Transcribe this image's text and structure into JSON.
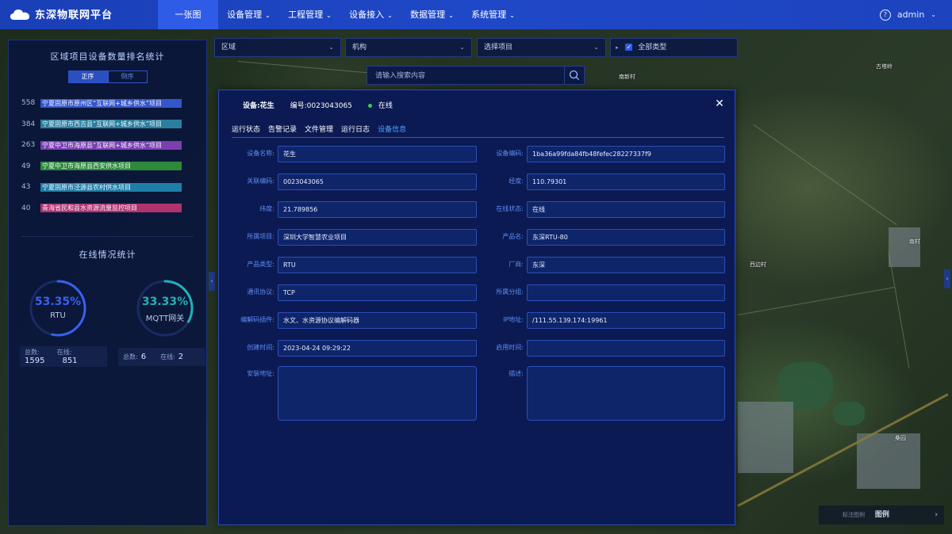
{
  "app": {
    "title": "东深物联网平台",
    "user": "admin"
  },
  "nav": {
    "items": [
      {
        "label": "一张图",
        "dropdown": false
      },
      {
        "label": "设备管理",
        "dropdown": true
      },
      {
        "label": "工程管理",
        "dropdown": true
      },
      {
        "label": "设备接入",
        "dropdown": true
      },
      {
        "label": "数据管理",
        "dropdown": true
      },
      {
        "label": "系统管理",
        "dropdown": true
      }
    ]
  },
  "left": {
    "rank_title": "区域项目设备数量排名统计",
    "sort": {
      "asc": "正序",
      "desc": "倒序"
    },
    "rankings": [
      {
        "count": "558",
        "name": "宁夏固原市原州区“互联网+城乡供水”项目",
        "color": "#3556c9"
      },
      {
        "count": "384",
        "name": "宁夏固原市西吉县“互联网+城乡供水”项目",
        "color": "#2a7f9c"
      },
      {
        "count": "263",
        "name": "宁夏中卫市海原县“互联网+城乡供水”项目",
        "color": "#7b3fb0"
      },
      {
        "count": "49",
        "name": "宁夏中卫市海原县西安供水项目",
        "color": "#2e8a3a"
      },
      {
        "count": "43",
        "name": "宁夏固原市泾源县农村供水项目",
        "color": "#1f7ea8"
      },
      {
        "count": "40",
        "name": "青海省民和县水资源流量监控项目",
        "color": "#b0336e"
      }
    ],
    "online_title": "在线情况统计",
    "gauges": [
      {
        "pct": "53.35%",
        "name": "RTU",
        "color": "#3a5ff0",
        "fraction": 0.5335,
        "total_label": "总数:",
        "total": "1595",
        "online_label": "在线:",
        "online": "851"
      },
      {
        "pct": "33.33%",
        "name": "MQTT网关",
        "color": "#1fb3b8",
        "fraction": 0.3333,
        "total_label": "总数:",
        "total": "6",
        "online_label": "在线:",
        "online": "2"
      }
    ]
  },
  "filters": {
    "region": "区域",
    "org": "机构",
    "project_placeholder": "选择项目",
    "all_types": "全部类型"
  },
  "search": {
    "placeholder": "请输入搜索内容"
  },
  "modal": {
    "device": "设备:花生",
    "code": "编号:0023043065",
    "status": "在线",
    "tabs": [
      "运行状态",
      "告警记录",
      "文件管理",
      "运行日志",
      "设备信息"
    ],
    "fields": [
      {
        "label": "设备名称:",
        "value": "花生"
      },
      {
        "label": "设备编码:",
        "value": "1ba36a99fda84fb48fefec28227337f9"
      },
      {
        "label": "关联编码:",
        "value": "0023043065"
      },
      {
        "label": "经度:",
        "value": "110.79301"
      },
      {
        "label": "纬度:",
        "value": "21.789856"
      },
      {
        "label": "在线状态:",
        "value": "在线"
      },
      {
        "label": "所属项目:",
        "value": "深圳大学智慧农业项目"
      },
      {
        "label": "产品名:",
        "value": "东深RTU-80"
      },
      {
        "label": "产品类型:",
        "value": "RTU"
      },
      {
        "label": "厂商:",
        "value": "东深"
      },
      {
        "label": "通讯协议:",
        "value": "TCP"
      },
      {
        "label": "所属分组:",
        "value": ""
      },
      {
        "label": "编解码插件:",
        "value": "水文、水资源协议编解码器"
      },
      {
        "label": "IP地址:",
        "value": "/111.55.139.174:19961"
      },
      {
        "label": "创建时间:",
        "value": "2023-04-24 09:29:22"
      },
      {
        "label": "启用时间:",
        "value": ""
      }
    ],
    "install_label": "安装地址:",
    "desc_label": "描述:"
  },
  "map_labels": {
    "l1": "古塔岭",
    "l2": "南村",
    "l3": "西边村",
    "l4": "桑园",
    "l5": "南新村"
  },
  "legend": {
    "label": "图例",
    "extra": "标注图例"
  }
}
